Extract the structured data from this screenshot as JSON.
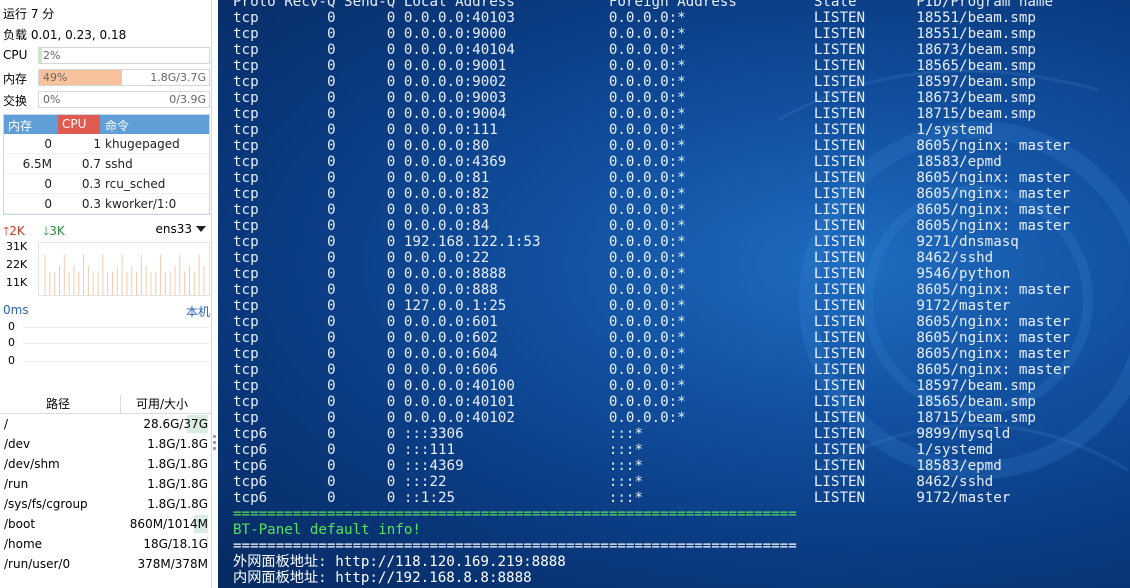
{
  "sidebar": {
    "uptime": "运行 7 分",
    "load": "负载 0.01, 0.23, 0.18",
    "resources": [
      {
        "label": "CPU",
        "percent_text": "2%",
        "value": "",
        "percent": 2,
        "color": "#cde8c9"
      },
      {
        "label": "内存",
        "percent_text": "49%",
        "value": "1.8G/3.7G",
        "percent": 49,
        "color": "#f7c29c"
      },
      {
        "label": "交换",
        "percent_text": "0%",
        "value": "0/3.9G",
        "percent": 0,
        "color": "#cde8c9"
      }
    ],
    "process_table": {
      "headers": {
        "mem": "内存",
        "cpu": "CPU",
        "cmd": "命令"
      },
      "rows": [
        {
          "mem": "0",
          "cpu": "1",
          "cmd": "khugepaged"
        },
        {
          "mem": "6.5M",
          "cpu": "0.7",
          "cmd": "sshd"
        },
        {
          "mem": "0",
          "cpu": "0.3",
          "cmd": "rcu_sched"
        },
        {
          "mem": "0",
          "cpu": "0.3",
          "cmd": "kworker/1:0"
        }
      ]
    },
    "network": {
      "upload": "2K",
      "download": "3K",
      "interface": "ens33",
      "y_labels": [
        "31K",
        "22K",
        "11K"
      ]
    },
    "latency": {
      "label": "0ms",
      "target": "本机",
      "y_labels": [
        "0",
        "0",
        "0"
      ]
    },
    "disk": {
      "headers": {
        "path": "路径",
        "size": "可用/大小"
      },
      "rows": [
        {
          "path": "/",
          "size": "28.6G/37G",
          "used_fraction": 0.23
        },
        {
          "path": "/dev",
          "size": "1.8G/1.8G",
          "used_fraction": 0
        },
        {
          "path": "/dev/shm",
          "size": "1.8G/1.8G",
          "used_fraction": 0
        },
        {
          "path": "/run",
          "size": "1.8G/1.8G",
          "used_fraction": 0
        },
        {
          "path": "/sys/fs/cgroup",
          "size": "1.8G/1.8G",
          "used_fraction": 0
        },
        {
          "path": "/boot",
          "size": "860M/1014M",
          "used_fraction": 0.15
        },
        {
          "path": "/home",
          "size": "18G/18.1G",
          "used_fraction": 0.01
        },
        {
          "path": "/run/user/0",
          "size": "378M/378M",
          "used_fraction": 0
        }
      ]
    }
  },
  "terminal": {
    "lines": [
      {
        "text": "Proto Recv-Q Send-Q Local Address           Foreign Address         State       PID/Program name",
        "style": ""
      },
      {
        "text": "tcp        0      0 0.0.0.0:40103           0.0.0.0:*               LISTEN      18551/beam.smp",
        "style": ""
      },
      {
        "text": "tcp        0      0 0.0.0.0:9000            0.0.0.0:*               LISTEN      18551/beam.smp",
        "style": ""
      },
      {
        "text": "tcp        0      0 0.0.0.0:40104           0.0.0.0:*               LISTEN      18673/beam.smp",
        "style": ""
      },
      {
        "text": "tcp        0      0 0.0.0.0:9001            0.0.0.0:*               LISTEN      18565/beam.smp",
        "style": ""
      },
      {
        "text": "tcp        0      0 0.0.0.0:9002            0.0.0.0:*               LISTEN      18597/beam.smp",
        "style": ""
      },
      {
        "text": "tcp        0      0 0.0.0.0:9003            0.0.0.0:*               LISTEN      18673/beam.smp",
        "style": ""
      },
      {
        "text": "tcp        0      0 0.0.0.0:9004            0.0.0.0:*               LISTEN      18715/beam.smp",
        "style": ""
      },
      {
        "text": "tcp        0      0 0.0.0.0:111             0.0.0.0:*               LISTEN      1/systemd",
        "style": ""
      },
      {
        "text": "tcp        0      0 0.0.0.0:80              0.0.0.0:*               LISTEN      8605/nginx: master",
        "style": ""
      },
      {
        "text": "tcp        0      0 0.0.0.0:4369            0.0.0.0:*               LISTEN      18583/epmd",
        "style": ""
      },
      {
        "text": "tcp        0      0 0.0.0.0:81              0.0.0.0:*               LISTEN      8605/nginx: master",
        "style": ""
      },
      {
        "text": "tcp        0      0 0.0.0.0:82              0.0.0.0:*               LISTEN      8605/nginx: master",
        "style": ""
      },
      {
        "text": "tcp        0      0 0.0.0.0:83              0.0.0.0:*               LISTEN      8605/nginx: master",
        "style": ""
      },
      {
        "text": "tcp        0      0 0.0.0.0:84              0.0.0.0:*               LISTEN      8605/nginx: master",
        "style": ""
      },
      {
        "text": "tcp        0      0 192.168.122.1:53        0.0.0.0:*               LISTEN      9271/dnsmasq",
        "style": ""
      },
      {
        "text": "tcp        0      0 0.0.0.0:22              0.0.0.0:*               LISTEN      8462/sshd",
        "style": ""
      },
      {
        "text": "tcp        0      0 0.0.0.0:8888            0.0.0.0:*               LISTEN      9546/python",
        "style": ""
      },
      {
        "text": "tcp        0      0 0.0.0.0:888             0.0.0.0:*               LISTEN      8605/nginx: master",
        "style": ""
      },
      {
        "text": "tcp        0      0 127.0.0.1:25            0.0.0.0:*               LISTEN      9172/master",
        "style": ""
      },
      {
        "text": "tcp        0      0 0.0.0.0:601             0.0.0.0:*               LISTEN      8605/nginx: master",
        "style": ""
      },
      {
        "text": "tcp        0      0 0.0.0.0:602             0.0.0.0:*               LISTEN      8605/nginx: master",
        "style": ""
      },
      {
        "text": "tcp        0      0 0.0.0.0:604             0.0.0.0:*               LISTEN      8605/nginx: master",
        "style": ""
      },
      {
        "text": "tcp        0      0 0.0.0.0:606             0.0.0.0:*               LISTEN      8605/nginx: master",
        "style": ""
      },
      {
        "text": "tcp        0      0 0.0.0.0:40100           0.0.0.0:*               LISTEN      18597/beam.smp",
        "style": ""
      },
      {
        "text": "tcp        0      0 0.0.0.0:40101           0.0.0.0:*               LISTEN      18565/beam.smp",
        "style": ""
      },
      {
        "text": "tcp        0      0 0.0.0.0:40102           0.0.0.0:*               LISTEN      18715/beam.smp",
        "style": ""
      },
      {
        "text": "tcp6       0      0 :::3306                 :::*                    LISTEN      9899/mysqld",
        "style": ""
      },
      {
        "text": "tcp6       0      0 :::111                  :::*                    LISTEN      1/systemd",
        "style": ""
      },
      {
        "text": "tcp6       0      0 :::4369                 :::*                    LISTEN      18583/epmd",
        "style": ""
      },
      {
        "text": "tcp6       0      0 :::22                   :::*                    LISTEN      8462/sshd",
        "style": ""
      },
      {
        "text": "tcp6       0      0 ::1:25                  :::*                    LISTEN      9172/master",
        "style": ""
      },
      {
        "text": "==================================================================",
        "style": "t-green"
      },
      {
        "text": "BT-Panel default info!",
        "style": "t-green"
      },
      {
        "text": "==================================================================",
        "style": "t-white"
      },
      {
        "text": "外网面板地址: http://118.120.169.219:8888",
        "style": "t-white"
      },
      {
        "text": "内网面板地址: http://192.168.8.8:8888",
        "style": "t-white"
      }
    ]
  },
  "colors": {
    "terminal_bg": "#0d4a98",
    "terminal_text": "#e8eef8",
    "banner_green": "#55e35a",
    "header_blue": "#5f9ed6",
    "header_red": "#e05a4f",
    "mem_bar": "#f7c29c",
    "link_blue": "#2a62b5",
    "upload_red": "#c0392b",
    "download_green": "#2d8a3a"
  }
}
